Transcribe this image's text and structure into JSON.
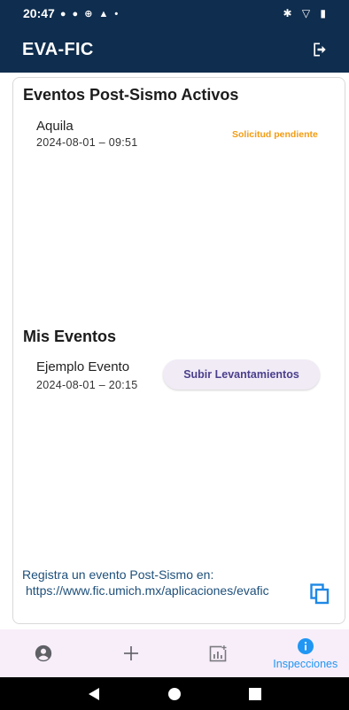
{
  "status_bar": {
    "time": "20:47",
    "notification_icons": "● ● ⊕ ▲ •",
    "system_icons": "✱ ▽ ▮"
  },
  "app_bar": {
    "title": "EVA-FIC",
    "logout_icon": "logout-icon"
  },
  "active_events": {
    "title": "Eventos Post-Sismo Activos",
    "items": [
      {
        "name": "Aquila",
        "date": "2024-08-01 – 09:51",
        "status": "Solicitud pendiente"
      }
    ]
  },
  "my_events": {
    "title": "Mis Eventos",
    "items": [
      {
        "name": "Ejemplo Evento",
        "date": "2024-08-01 – 20:15",
        "action_label": "Subir Levantamientos"
      }
    ]
  },
  "footer": {
    "text": "Registra un evento Post-Sismo en:",
    "url": "https://www.fic.umich.mx/aplicaciones/evafic",
    "copy_icon": "copy-icon"
  },
  "bottom_nav": {
    "items": [
      {
        "icon": "account-icon",
        "label": ""
      },
      {
        "icon": "add-icon",
        "label": ""
      },
      {
        "icon": "analytics-icon",
        "label": ""
      },
      {
        "icon": "info-icon",
        "label": "Inspecciones",
        "active": true
      }
    ]
  },
  "colors": {
    "primary": "#0f2d4e",
    "pending": "#f39c12",
    "active_nav": "#2196f3",
    "nav_bg": "#f7eef9",
    "button_text": "#4a3f8c"
  }
}
